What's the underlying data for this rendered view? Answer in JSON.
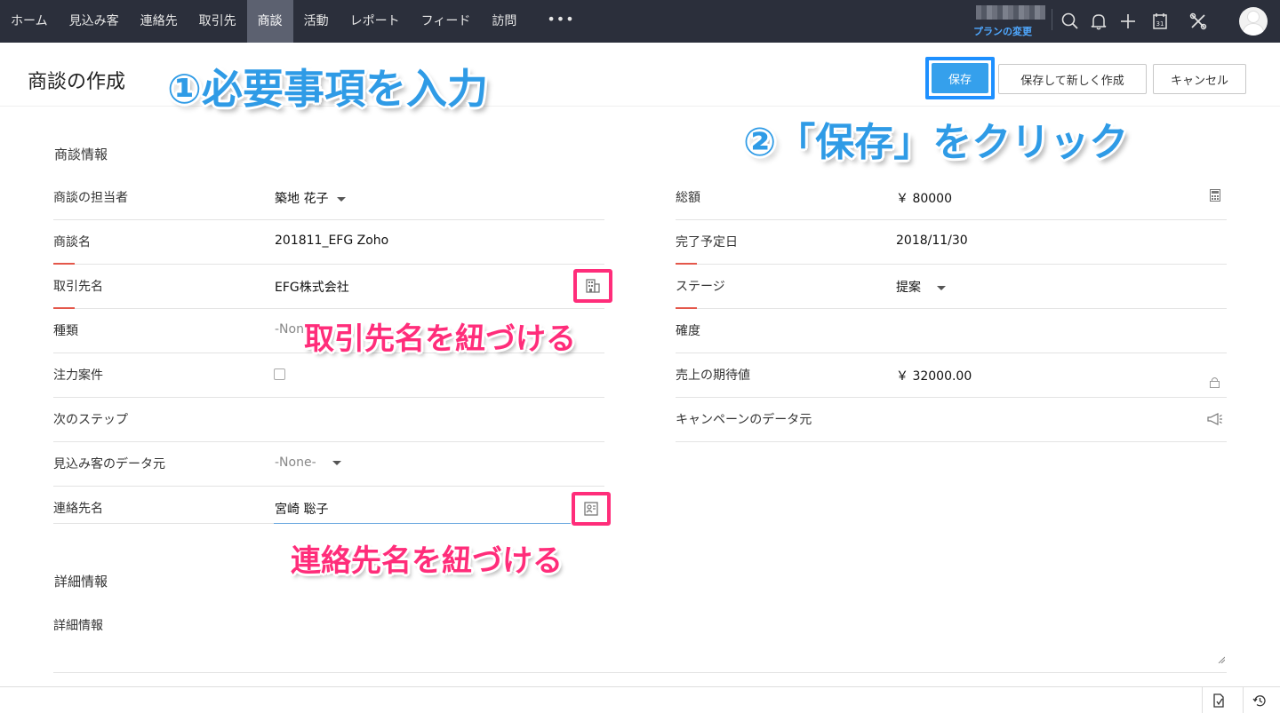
{
  "nav": {
    "items": [
      "ホーム",
      "見込み客",
      "連絡先",
      "取引先",
      "商談",
      "活動",
      "レポート",
      "フィード",
      "訪問"
    ],
    "active_index": 4,
    "more": "•••",
    "plan_link": "プランの変更",
    "icons": [
      "search-icon",
      "bell-icon",
      "plus-icon",
      "calendar-icon",
      "tools-icon",
      "avatar"
    ]
  },
  "header": {
    "title": "商談の作成",
    "save_label": "保存",
    "save_new_label": "保存して新しく作成",
    "cancel_label": "キャンセル"
  },
  "annotations": {
    "step1": "①必要事項を入力",
    "step2": "②「保存」をクリック",
    "link_account": "取引先名を紐づける",
    "link_contact": "連絡先名を紐づける"
  },
  "form": {
    "section_title": "商談情報",
    "left": [
      {
        "label": "商談の担当者",
        "value": "築地 花子"
      },
      {
        "label": "商談名",
        "value": "201811_EFG Zoho"
      },
      {
        "label": "取引先名",
        "value": "EFG株式会社"
      },
      {
        "label": "種類",
        "value": "-None-"
      },
      {
        "label": "注力案件",
        "value": ""
      },
      {
        "label": "次のステップ",
        "value": ""
      },
      {
        "label": "見込み客のデータ元",
        "value": "-None-"
      },
      {
        "label": "連絡先名",
        "value": "宮崎 聡子"
      }
    ],
    "right": [
      {
        "label": "総額",
        "value": "￥ 80000"
      },
      {
        "label": "完了予定日",
        "value": "2018/11/30"
      },
      {
        "label": "ステージ",
        "value": "提案"
      },
      {
        "label": "確度",
        "value": ""
      },
      {
        "label": "売上の期待値",
        "value": "￥ 32000.00"
      },
      {
        "label": "キャンペーンのデータ元",
        "value": ""
      }
    ],
    "detail_section_title": "詳細情報",
    "detail_label": "詳細情報"
  },
  "colors": {
    "nav_bg": "#2b2f3b",
    "accent_blue": "#2f9be6",
    "highlight_pink": "#ff2d7a",
    "required_red": "#e4574a"
  }
}
